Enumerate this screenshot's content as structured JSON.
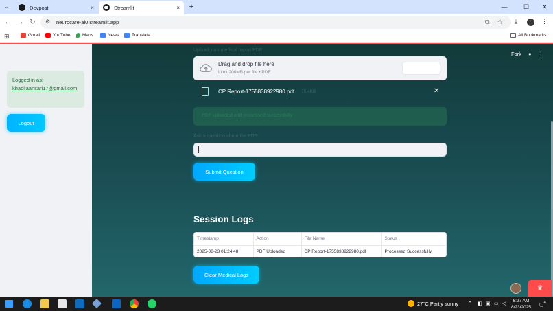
{
  "browser": {
    "tabs": [
      {
        "title": "Devpost",
        "close": "×"
      },
      {
        "title": "Streamlit",
        "close": "×"
      }
    ],
    "new_tab": "+",
    "window_controls": {
      "minimize": "—",
      "maximize": "☐",
      "close": "✕"
    },
    "url": "neurocare-ai0.streamlit.app",
    "bookmarks": [
      "Gmail",
      "YouTube",
      "Maps",
      "News",
      "Translate"
    ],
    "all_bookmarks": "All Bookmarks"
  },
  "sidebar": {
    "login_label": "Logged in as:",
    "email": "khadijaansari17@gmail.com",
    "logout_label": "Logout"
  },
  "header": {
    "fork_label": "Fork"
  },
  "upload": {
    "label": "Upload your medical report PDF",
    "drop_title": "Drag and drop file here",
    "drop_sub": "Limit 200MB per file • PDF",
    "file_name": "CP Report-1755838922980.pdf",
    "file_size": "76.4KB",
    "success_text": "PDF uploaded and processed successfully"
  },
  "question": {
    "label": "Ask a question about the PDF",
    "value": "",
    "submit_label": "Submit Question"
  },
  "logs": {
    "title": "Session Logs",
    "ghost": "link",
    "columns": [
      "Timestamp",
      "Action",
      "File Name",
      "Status"
    ],
    "rows": [
      [
        "2025-08-23 01:24:48",
        "PDF Uploaded",
        "CP Report-1755838922980.pdf",
        "Processed Successfully"
      ]
    ],
    "clear_label": "Clear Medical Logs"
  },
  "taskbar": {
    "weather": "27°C  Partly sunny",
    "time": "6:27 AM",
    "date": "8/23/2025",
    "notification_count": "4"
  },
  "colors": {
    "accent": "#00c8ff",
    "streamlit_red": "#ff4b4b",
    "main_bg": "#1a4f55",
    "sidebar_bg": "#f0f2f6"
  }
}
